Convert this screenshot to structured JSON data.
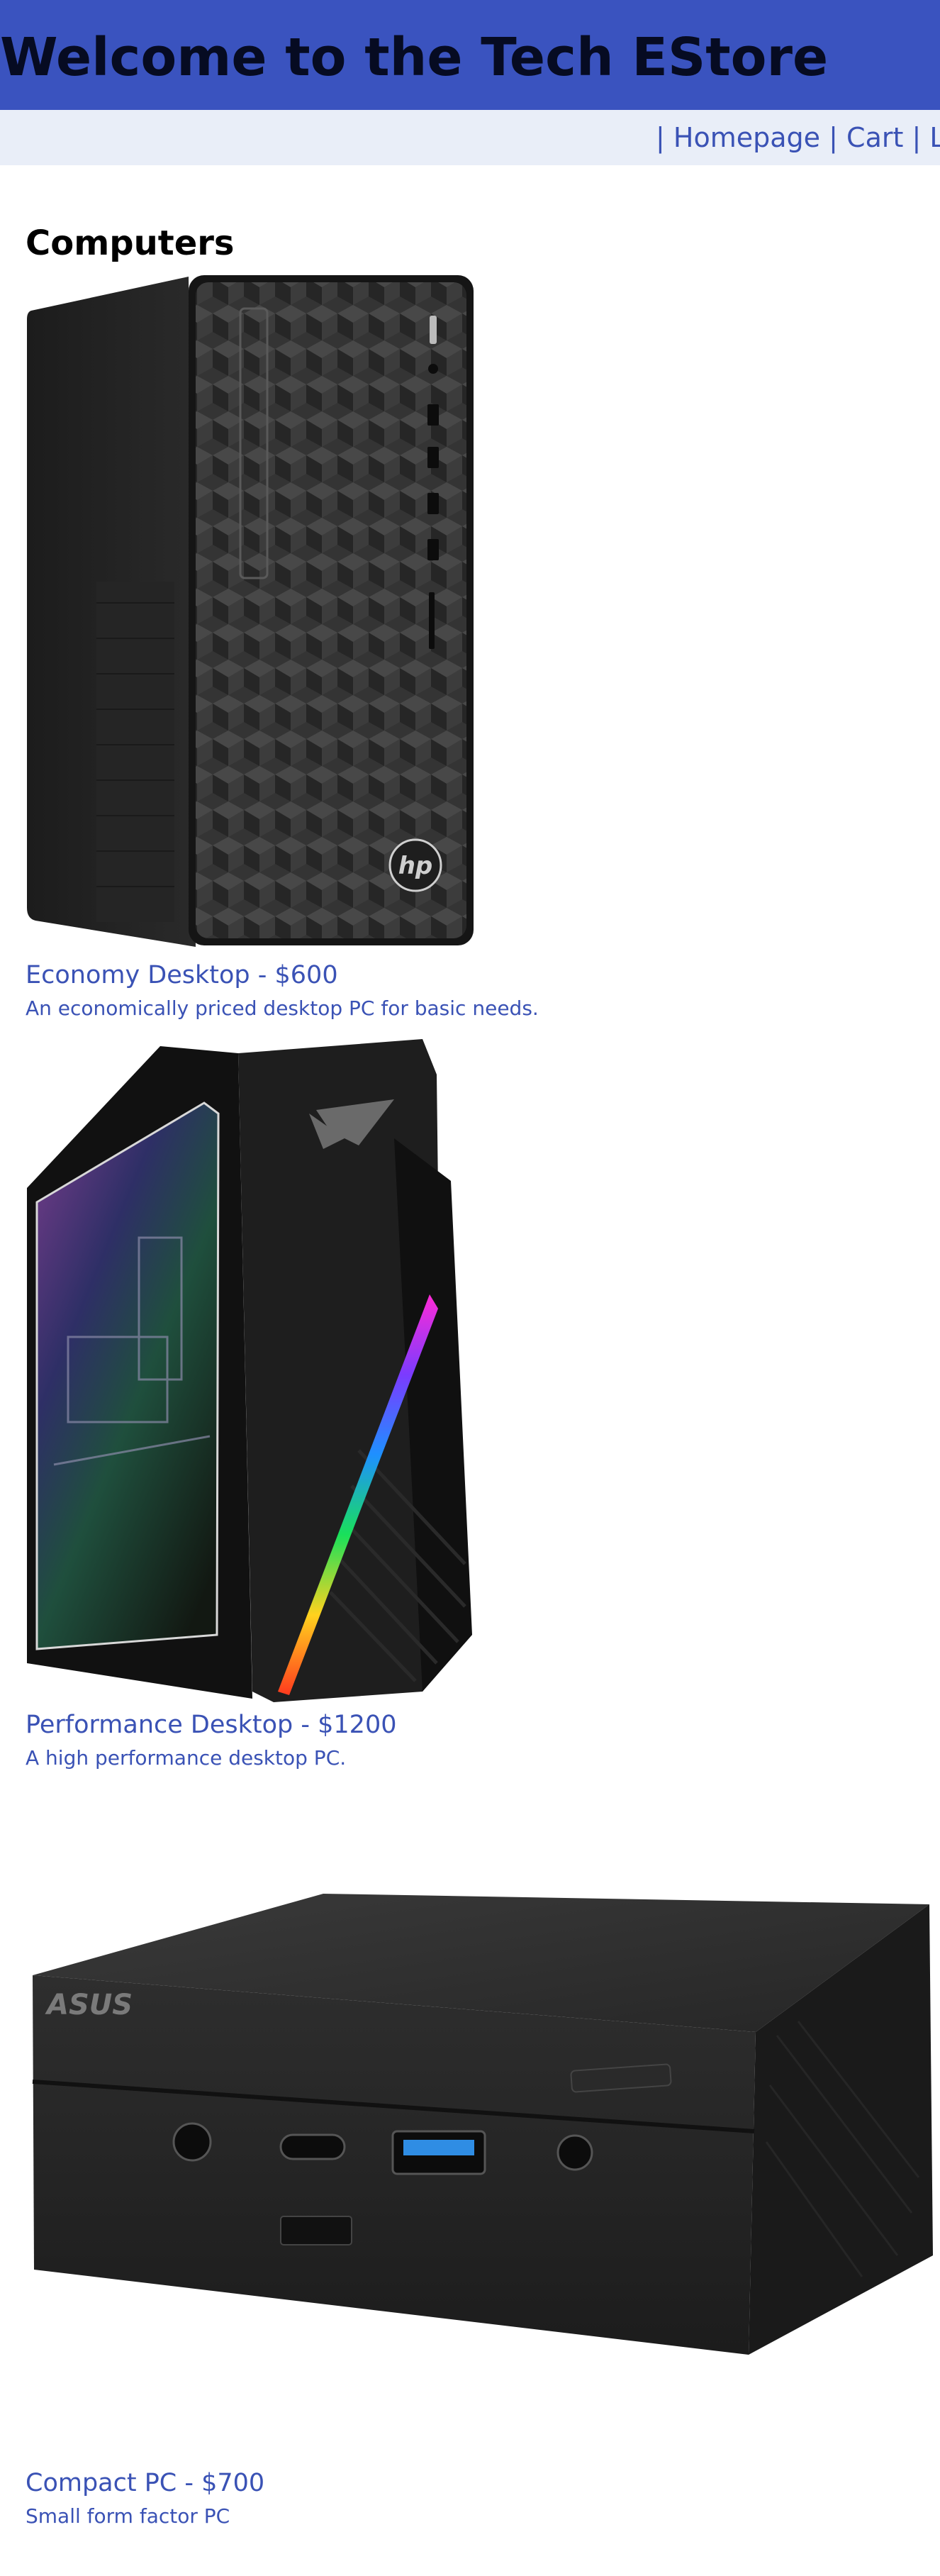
{
  "header": {
    "title": "Welcome to the Tech EStore"
  },
  "nav": {
    "separator": "|",
    "links": [
      {
        "label": "Homepage"
      },
      {
        "label": "Cart"
      },
      {
        "label": "Login"
      }
    ]
  },
  "section": {
    "title": "Computers"
  },
  "products": [
    {
      "name": "Economy Desktop - $600",
      "description": "An economically priced desktop PC for basic needs.",
      "image_icon": "hp-tower-desktop-image"
    },
    {
      "name": "Performance Desktop - $1200",
      "description": "A high performance desktop PC.",
      "image_icon": "rog-gaming-desktop-image"
    },
    {
      "name": "Compact PC - $700",
      "description": "Small form factor PC",
      "image_icon": "asus-mini-pc-image"
    }
  ],
  "colors": {
    "header_bg": "#3a53bf",
    "nav_bg": "#e9eef8",
    "link": "#3a52b5",
    "title_text": "#060b22"
  }
}
